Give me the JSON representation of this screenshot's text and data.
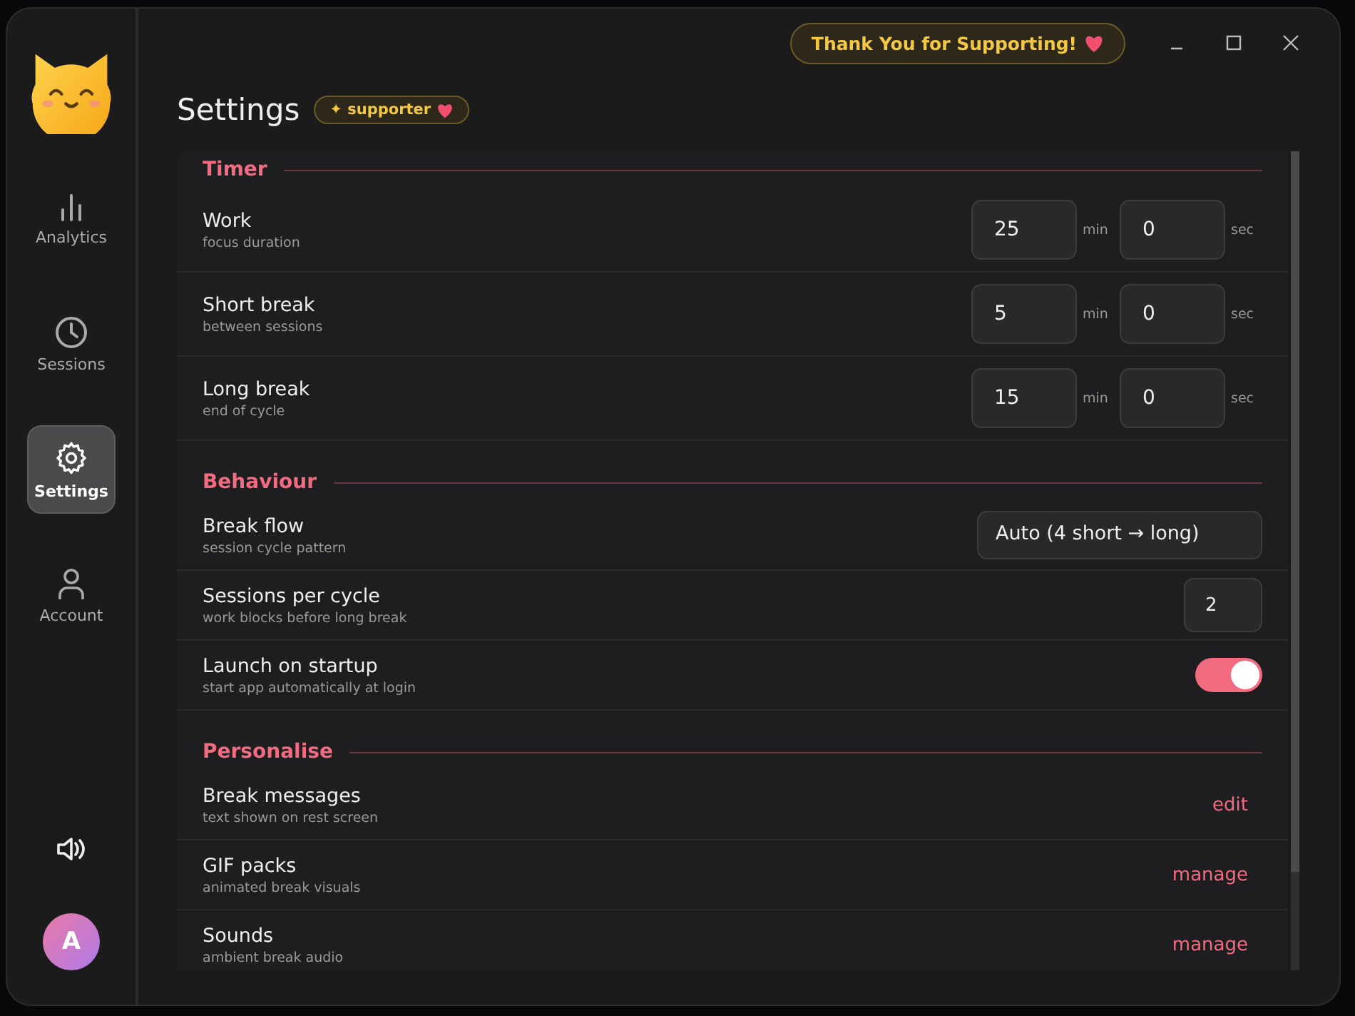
{
  "sidebar": {
    "items": [
      {
        "label": "Analytics",
        "kind": "chart",
        "selected": false
      },
      {
        "label": "Sessions",
        "kind": "history",
        "selected": false
      },
      {
        "label": "Settings",
        "kind": "settings",
        "selected": true
      },
      {
        "label": "Account",
        "kind": "account",
        "selected": false
      }
    ],
    "avatar": "A"
  },
  "titlebar": {
    "support_button": "Thank You for Supporting!"
  },
  "header": {
    "title": "Settings",
    "badge": "✦ supporter"
  },
  "sections": [
    {
      "title": "Timer",
      "rows": [
        {
          "kind": "duration",
          "label": "Work",
          "hint": "focus duration",
          "minutes": "25",
          "min_unit": "min",
          "seconds": "0",
          "sec_unit": "sec"
        },
        {
          "kind": "duration",
          "label": "Short break",
          "hint": "between sessions",
          "minutes": "5",
          "min_unit": "min",
          "seconds": "0",
          "sec_unit": "sec"
        },
        {
          "kind": "duration",
          "label": "Long break",
          "hint": "end of cycle",
          "minutes": "15",
          "min_unit": "min",
          "seconds": "0",
          "sec_unit": "sec"
        }
      ]
    },
    {
      "title": "Behaviour",
      "rows": [
        {
          "kind": "select",
          "label": "Break flow",
          "hint": "session cycle pattern",
          "value": "Auto (4 short → long)"
        },
        {
          "kind": "number",
          "label": "Sessions per cycle",
          "hint": "work blocks before long break",
          "value": "2"
        },
        {
          "kind": "toggle",
          "label": "Launch on startup",
          "hint": "start app automatically at login",
          "on": true
        }
      ]
    },
    {
      "title": "Personalise",
      "rows": [
        {
          "kind": "link",
          "label": "Break messages",
          "hint": "text shown on rest screen",
          "action": "edit"
        },
        {
          "kind": "link",
          "label": "GIF packs",
          "hint": "animated break visuals",
          "action": "manage"
        },
        {
          "kind": "link",
          "label": "Sounds",
          "hint": "ambient break audio",
          "action": "manage"
        }
      ]
    }
  ]
}
